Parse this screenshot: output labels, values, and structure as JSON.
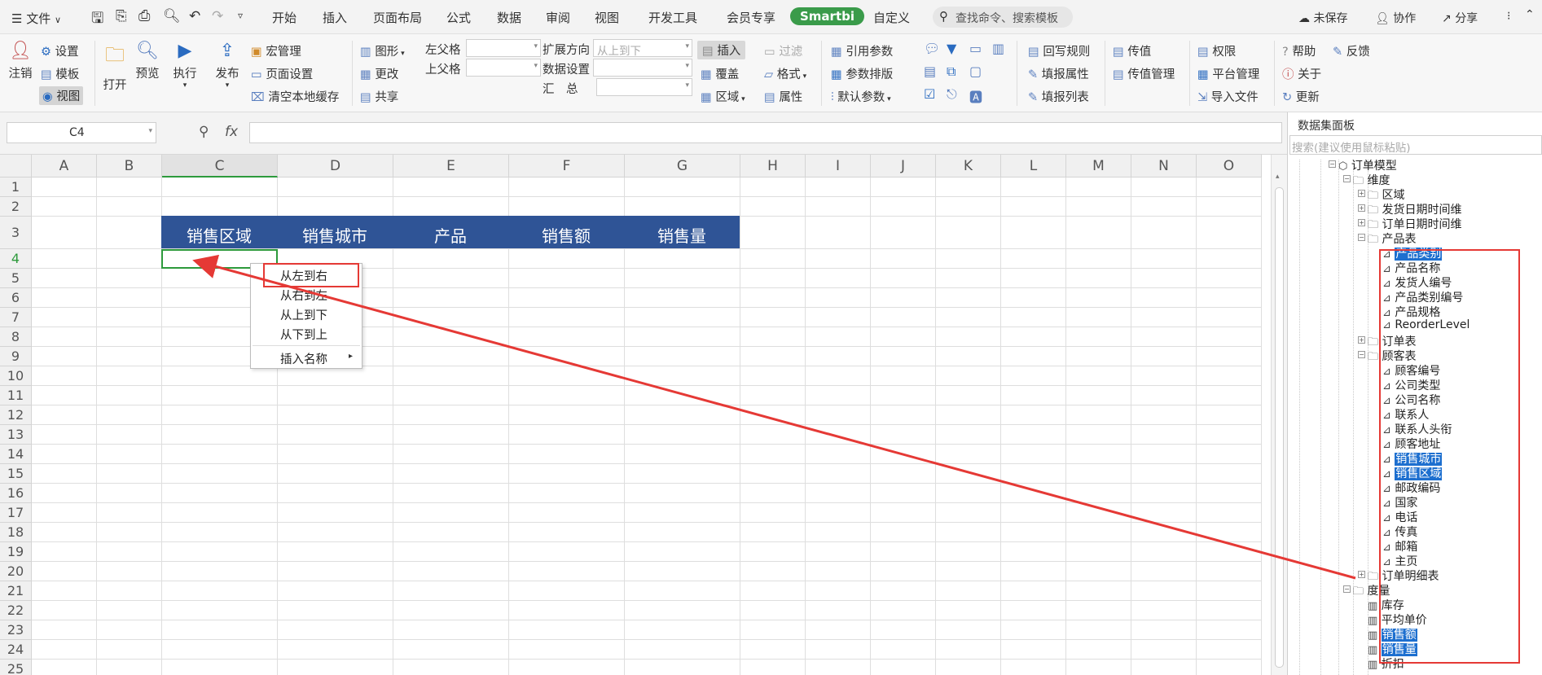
{
  "titlebar": {
    "menu": "文件",
    "tabs": [
      "开始",
      "插入",
      "页面布局",
      "公式",
      "数据",
      "审阅",
      "视图",
      "开发工具",
      "会员专享",
      "Smartbi",
      "自定义"
    ],
    "active_tab": "Smartbi",
    "search_placeholder": "查找命令、搜索模板",
    "unsaved": "未保存",
    "collab": "协作",
    "share": "分享"
  },
  "ribbon": {
    "logout": "注销",
    "settings": "设置",
    "template": "模板",
    "view": "视图",
    "open": "打开",
    "preview": "预览",
    "execute": "执行",
    "publish": "发布",
    "macro_manage": "宏管理",
    "page_setup": "页面设置",
    "clear_cache": "清空本地缓存",
    "chart": "图形",
    "change": "更改",
    "share": "共享",
    "left_parent": "左父格",
    "top_parent": "上父格",
    "expand_dir": "扩展方向",
    "expand_dir_value": "从上到下",
    "data_setting": "数据设置",
    "summary": "汇　总",
    "insert": "插入",
    "overwrite": "覆盖",
    "region": "区域",
    "filter": "过滤",
    "format": "格式",
    "property": "属性",
    "ref_param": "引用参数",
    "param_layout": "参数排版",
    "default_param": "默认参数",
    "writeback_rule": "回写规则",
    "fill_property": "填报属性",
    "fill_list": "填报列表",
    "pass_value": "传值",
    "pass_value_manage": "传值管理",
    "permission": "权限",
    "platform_manage": "平台管理",
    "import_file": "导入文件",
    "help": "帮助",
    "feedback": "反馈",
    "about": "关于",
    "update": "更新"
  },
  "formula": {
    "cell_ref": "C4",
    "fx": "fx",
    "value": ""
  },
  "sheet": {
    "columns": [
      "A",
      "B",
      "C",
      "D",
      "E",
      "F",
      "G",
      "H",
      "I",
      "J",
      "K",
      "L",
      "M",
      "N",
      "O"
    ],
    "rows": [
      "1",
      "2",
      "3",
      "4",
      "5",
      "6",
      "7",
      "8",
      "9",
      "10",
      "11",
      "12",
      "13",
      "14",
      "15",
      "16",
      "17",
      "18",
      "19",
      "20",
      "21",
      "22",
      "23",
      "24",
      "25"
    ],
    "headers": [
      "销售区域",
      "销售城市",
      "产品",
      "销售额",
      "销售量"
    ],
    "header_bg": "#2f5496",
    "selected_cell": "C4"
  },
  "context_menu": {
    "items": [
      "从左到右",
      "从右到左",
      "从上到下",
      "从下到上"
    ],
    "insert_name": "插入名称"
  },
  "panel": {
    "title": "数据集面板",
    "search_placeholder": "搜索(建议使用鼠标粘贴)",
    "tree": {
      "root": "订单模型",
      "dimension": "维度",
      "region": "区域",
      "ship_date": "发货日期时间维",
      "order_date": "订单日期时间维",
      "product_table": "产品表",
      "product_fields": [
        "产品类别",
        "产品名称",
        "发货人编号",
        "产品类别编号",
        "产品规格",
        "ReorderLevel"
      ],
      "order_table": "订单表",
      "customer_table": "顾客表",
      "customer_fields": [
        "顾客编号",
        "公司类型",
        "公司名称",
        "联系人",
        "联系人头衔",
        "顾客地址",
        "销售城市",
        "销售区域",
        "邮政编码",
        "国家",
        "电话",
        "传真",
        "邮箱",
        "主页"
      ],
      "order_detail": "订单明细表",
      "measure": "度量",
      "measure_fields": [
        "库存",
        "平均单价",
        "销售额",
        "销售量",
        "折扣"
      ]
    }
  }
}
